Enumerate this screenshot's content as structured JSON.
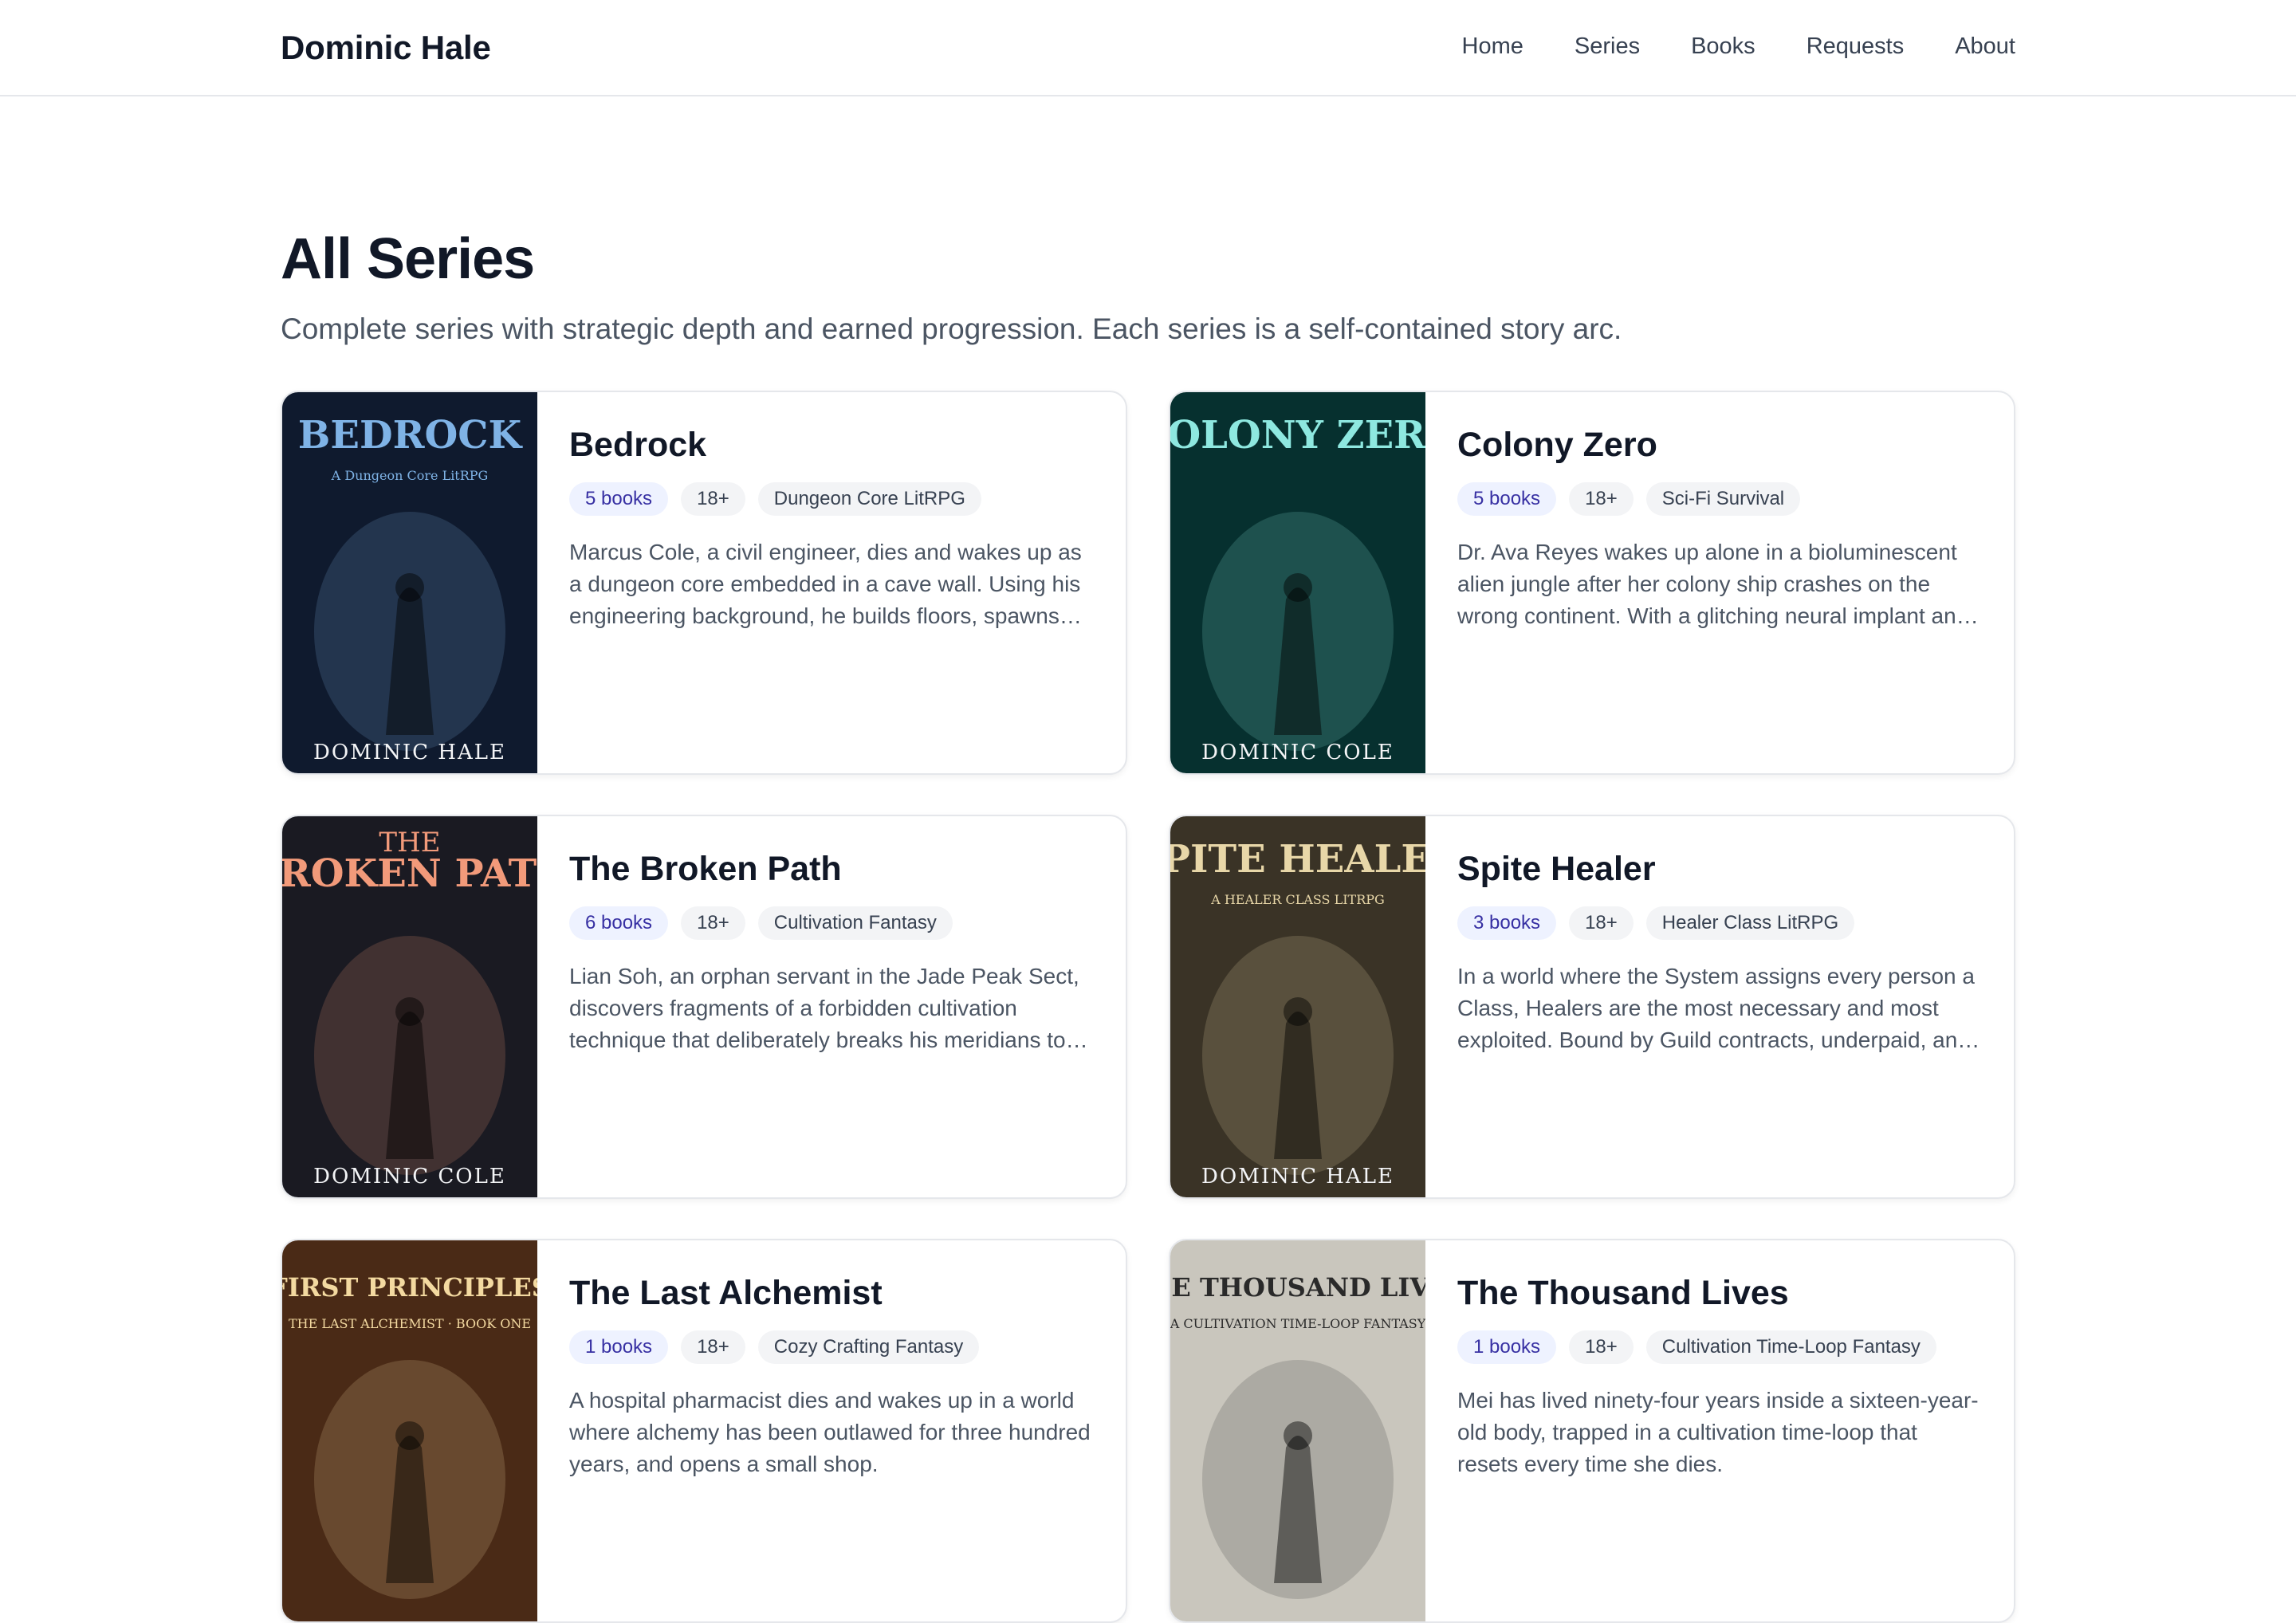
{
  "site": {
    "brand": "Dominic Hale",
    "nav": [
      "Home",
      "Series",
      "Books",
      "Requests",
      "About"
    ]
  },
  "page": {
    "title": "All Series",
    "subtitle": "Complete series with strategic depth and earned progression. Each series is a self-contained story arc."
  },
  "series": [
    {
      "title": "Bedrock",
      "books": "5 books",
      "age": "18+",
      "genre": "Dungeon Core LitRPG",
      "description": "Marcus Cole, a civil engineer, dies and wakes up as a dungeon core embedded in a cave wall. Using his engineering background, he builds floors, spawns monsters and devises traps with careful strategy.",
      "cover": {
        "title": "BEDROCK",
        "subtitle": "A Dungeon Core LitRPG",
        "author": "DOMINIC HALE",
        "bg": "#0f1a2e",
        "accent": "#7fb3e6"
      }
    },
    {
      "title": "Colony Zero",
      "books": "5 books",
      "age": "18+",
      "genre": "Sci-Fi Survival",
      "description": "Dr. Ava Reyes wakes up alone in a bioluminescent alien jungle after her colony ship crashes on the wrong continent. With a glitching neural implant and limited supplies, she must survive.",
      "cover": {
        "title": "COLONY ZERO",
        "subtitle": "",
        "author": "DOMINIC COLE",
        "bg": "#06302f",
        "accent": "#8ee8e0"
      }
    },
    {
      "title": "The Broken Path",
      "books": "6 books",
      "age": "18+",
      "genre": "Cultivation Fantasy",
      "description": "Lian Soh, an orphan servant in the Jade Peak Sect, discovers fragments of a forbidden cultivation technique that deliberately breaks his meridians to rebuild them stronger than before.",
      "cover": {
        "title": "BROKEN PATH",
        "subtitle": "THE",
        "author": "DOMINIC COLE",
        "bg": "#1a1a22",
        "accent": "#f29a7a"
      }
    },
    {
      "title": "Spite Healer",
      "books": "3 books",
      "age": "18+",
      "genre": "Healer Class LitRPG",
      "description": "In a world where the System assigns every person a Class, Healers are the most necessary and most exploited. Bound by Guild contracts, underpaid, and overworked, one healer fights back.",
      "cover": {
        "title": "SPITE HEALER",
        "subtitle": "A HEALER CLASS LITRPG",
        "author": "DOMINIC HALE",
        "bg": "#3a3326",
        "accent": "#e8d7a8"
      }
    },
    {
      "title": "The Last Alchemist",
      "books": "1 books",
      "age": "18+",
      "genre": "Cozy Crafting Fantasy",
      "description": "A hospital pharmacist dies and wakes up in a world where alchemy has been outlawed for three hundred years, and opens a small shop.",
      "cover": {
        "title": "FIRST PRINCIPLES",
        "subtitle": "THE LAST ALCHEMIST · BOOK ONE",
        "author": "",
        "bg": "#4a2a16",
        "accent": "#f3d9a0"
      }
    },
    {
      "title": "The Thousand Lives",
      "books": "1 books",
      "age": "18+",
      "genre": "Cultivation Time-Loop Fantasy",
      "description": "Mei has lived ninety-four years inside a sixteen-year-old body, trapped in a cultivation time-loop that resets every time she dies.",
      "cover": {
        "title": "THE THOUSAND LIVES",
        "subtitle": "A CULTIVATION TIME-LOOP FANTASY",
        "author": "",
        "bg": "#c9c6bd",
        "accent": "#2a2a2a"
      }
    }
  ]
}
